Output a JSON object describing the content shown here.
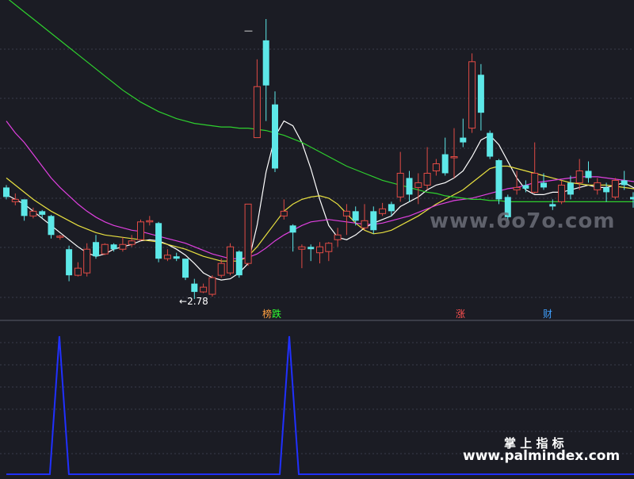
{
  "colors": {
    "background": "#1b1c24",
    "grid": "#3a3d4a",
    "up_candle": "#e14b45",
    "down_candle": "#5de8e8",
    "ma_white": "#ffffff",
    "ma_yellow": "#e8e040",
    "ma_magenta": "#e040e0",
    "ma_green": "#2ed02e",
    "indicator": "#2030ff",
    "watermark_grey": "#6b6e78"
  },
  "annotations": {
    "low_price": "2.78",
    "low_arrow": "←",
    "high_marker": "—",
    "event_labels": [
      {
        "first": "榜",
        "second": "跌",
        "first_color": "#ffa040",
        "second_color": "#30ff30"
      },
      {
        "first": "涨",
        "second": "",
        "first_color": "#ff5050",
        "second_color": ""
      },
      {
        "first": "财",
        "second": "",
        "first_color": "#40a0ff",
        "second_color": ""
      }
    ]
  },
  "watermarks": {
    "site_6070": "www.6o7o.com",
    "palm_title": "掌 上 指 标",
    "palm_url": "www.palmindex.com"
  },
  "chart_data": [
    {
      "type": "candlestick",
      "title": "",
      "candles": [
        {
          "o": 3.72,
          "c": 3.64,
          "h": 3.74,
          "l": 3.62,
          "dir": "down"
        },
        {
          "o": 3.6,
          "c": 3.62,
          "h": 3.67,
          "l": 3.57,
          "dir": "up"
        },
        {
          "o": 3.62,
          "c": 3.48,
          "h": 3.62,
          "l": 3.44,
          "dir": "down"
        },
        {
          "o": 3.48,
          "c": 3.52,
          "h": 3.55,
          "l": 3.46,
          "dir": "up"
        },
        {
          "o": 3.52,
          "c": 3.49,
          "h": 3.53,
          "l": 3.46,
          "dir": "down"
        },
        {
          "o": 3.48,
          "c": 3.32,
          "h": 3.49,
          "l": 3.29,
          "dir": "down"
        },
        {
          "o": 3.3,
          "c": 3.31,
          "h": 3.32,
          "l": 3.28,
          "dir": "up"
        },
        {
          "o": 3.2,
          "c": 2.98,
          "h": 3.23,
          "l": 2.93,
          "dir": "down"
        },
        {
          "o": 2.98,
          "c": 3.04,
          "h": 3.09,
          "l": 2.97,
          "dir": "up"
        },
        {
          "o": 3.0,
          "c": 3.2,
          "h": 3.25,
          "l": 2.97,
          "dir": "up"
        },
        {
          "o": 3.26,
          "c": 3.14,
          "h": 3.32,
          "l": 3.12,
          "dir": "down"
        },
        {
          "o": 3.16,
          "c": 3.24,
          "h": 3.25,
          "l": 3.15,
          "dir": "up"
        },
        {
          "o": 3.24,
          "c": 3.2,
          "h": 3.25,
          "l": 3.18,
          "dir": "down"
        },
        {
          "o": 3.2,
          "c": 3.24,
          "h": 3.3,
          "l": 3.18,
          "dir": "up"
        },
        {
          "o": 3.24,
          "c": 3.27,
          "h": 3.32,
          "l": 3.22,
          "dir": "up"
        },
        {
          "o": 3.28,
          "c": 3.43,
          "h": 3.45,
          "l": 3.27,
          "dir": "up"
        },
        {
          "o": 3.44,
          "c": 3.44,
          "h": 3.48,
          "l": 3.4,
          "dir": "up"
        },
        {
          "o": 3.42,
          "c": 3.12,
          "h": 3.43,
          "l": 3.09,
          "dir": "down"
        },
        {
          "o": 3.12,
          "c": 3.15,
          "h": 3.2,
          "l": 3.1,
          "dir": "up"
        },
        {
          "o": 3.14,
          "c": 3.12,
          "h": 3.17,
          "l": 3.1,
          "dir": "down"
        },
        {
          "o": 3.12,
          "c": 2.96,
          "h": 3.12,
          "l": 2.94,
          "dir": "down"
        },
        {
          "o": 2.91,
          "c": 2.84,
          "h": 2.95,
          "l": 2.78,
          "dir": "down"
        },
        {
          "o": 2.84,
          "c": 2.88,
          "h": 2.91,
          "l": 2.83,
          "dir": "up"
        },
        {
          "o": 2.82,
          "c": 2.96,
          "h": 2.98,
          "l": 2.8,
          "dir": "up"
        },
        {
          "o": 2.98,
          "c": 3.08,
          "h": 3.12,
          "l": 2.96,
          "dir": "up"
        },
        {
          "o": 3.0,
          "c": 3.22,
          "h": 3.25,
          "l": 2.98,
          "dir": "up"
        },
        {
          "o": 3.18,
          "c": 2.98,
          "h": 3.19,
          "l": 2.96,
          "dir": "down"
        },
        {
          "o": 3.08,
          "c": 3.58,
          "h": 3.58,
          "l": 3.06,
          "dir": "up"
        },
        {
          "o": 4.14,
          "c": 4.57,
          "h": 4.8,
          "l": 4.15,
          "dir": "up"
        },
        {
          "o": 4.96,
          "c": 4.58,
          "h": 5.14,
          "l": 4.28,
          "dir": "down"
        },
        {
          "o": 4.42,
          "c": 3.88,
          "h": 4.53,
          "l": 3.85,
          "dir": "down"
        },
        {
          "o": 3.48,
          "c": 3.52,
          "h": 3.62,
          "l": 3.45,
          "dir": "up"
        },
        {
          "o": 3.4,
          "c": 3.34,
          "h": 3.41,
          "l": 3.18,
          "dir": "down"
        },
        {
          "o": 3.2,
          "c": 3.22,
          "h": 3.24,
          "l": 3.04,
          "dir": "up"
        },
        {
          "o": 3.22,
          "c": 3.2,
          "h": 3.24,
          "l": 3.1,
          "dir": "down"
        },
        {
          "o": 3.17,
          "c": 3.22,
          "h": 3.26,
          "l": 3.08,
          "dir": "up"
        },
        {
          "o": 3.18,
          "c": 3.25,
          "h": 3.26,
          "l": 3.1,
          "dir": "up"
        },
        {
          "o": 3.28,
          "c": 3.32,
          "h": 3.38,
          "l": 3.22,
          "dir": "up"
        },
        {
          "o": 3.48,
          "c": 3.52,
          "h": 3.58,
          "l": 3.32,
          "dir": "up"
        },
        {
          "o": 3.52,
          "c": 3.44,
          "h": 3.56,
          "l": 3.4,
          "dir": "down"
        },
        {
          "o": 3.38,
          "c": 3.44,
          "h": 3.58,
          "l": 3.36,
          "dir": "up"
        },
        {
          "o": 3.52,
          "c": 3.36,
          "h": 3.56,
          "l": 3.33,
          "dir": "down"
        },
        {
          "o": 3.5,
          "c": 3.54,
          "h": 3.59,
          "l": 3.48,
          "dir": "up"
        },
        {
          "o": 3.58,
          "c": 3.52,
          "h": 3.6,
          "l": 3.48,
          "dir": "down"
        },
        {
          "o": 3.64,
          "c": 3.84,
          "h": 4.02,
          "l": 3.6,
          "dir": "up"
        },
        {
          "o": 3.8,
          "c": 3.66,
          "h": 3.86,
          "l": 3.6,
          "dir": "down"
        },
        {
          "o": 3.72,
          "c": 3.76,
          "h": 3.84,
          "l": 3.58,
          "dir": "up"
        },
        {
          "o": 3.74,
          "c": 3.84,
          "h": 4.06,
          "l": 3.7,
          "dir": "up"
        },
        {
          "o": 3.86,
          "c": 3.92,
          "h": 3.96,
          "l": 3.82,
          "dir": "up"
        },
        {
          "o": 4.0,
          "c": 3.84,
          "h": 4.14,
          "l": 3.82,
          "dir": "down"
        },
        {
          "o": 3.98,
          "c": 3.98,
          "h": 4.22,
          "l": 3.8,
          "dir": "up"
        },
        {
          "o": 4.14,
          "c": 4.1,
          "h": 4.3,
          "l": 4.06,
          "dir": "down"
        },
        {
          "o": 4.22,
          "c": 4.78,
          "h": 4.85,
          "l": 4.18,
          "dir": "up"
        },
        {
          "o": 4.67,
          "c": 4.35,
          "h": 4.76,
          "l": 4.2,
          "dir": "down"
        },
        {
          "o": 4.18,
          "c": 3.98,
          "h": 4.2,
          "l": 3.96,
          "dir": "down"
        },
        {
          "o": 3.95,
          "c": 3.62,
          "h": 3.96,
          "l": 3.58,
          "dir": "down"
        },
        {
          "o": 3.64,
          "c": 3.47,
          "h": 3.66,
          "l": 3.44,
          "dir": "down"
        },
        {
          "o": 3.7,
          "c": 3.72,
          "h": 3.86,
          "l": 3.66,
          "dir": "up"
        },
        {
          "o": 3.74,
          "c": 3.71,
          "h": 3.78,
          "l": 3.68,
          "dir": "down"
        },
        {
          "o": 3.68,
          "c": 3.84,
          "h": 4.1,
          "l": 3.67,
          "dir": "up"
        },
        {
          "o": 3.76,
          "c": 3.72,
          "h": 3.84,
          "l": 3.7,
          "dir": "down"
        },
        {
          "o": 3.58,
          "c": 3.56,
          "h": 3.62,
          "l": 3.53,
          "dir": "down"
        },
        {
          "o": 3.6,
          "c": 3.74,
          "h": 3.78,
          "l": 3.58,
          "dir": "up"
        },
        {
          "o": 3.76,
          "c": 3.66,
          "h": 3.82,
          "l": 3.62,
          "dir": "down"
        },
        {
          "o": 3.76,
          "c": 3.86,
          "h": 3.96,
          "l": 3.7,
          "dir": "up"
        },
        {
          "o": 3.86,
          "c": 3.8,
          "h": 3.94,
          "l": 3.76,
          "dir": "down"
        },
        {
          "o": 3.7,
          "c": 3.76,
          "h": 3.8,
          "l": 3.66,
          "dir": "up"
        },
        {
          "o": 3.72,
          "c": 3.68,
          "h": 3.76,
          "l": 3.6,
          "dir": "down"
        },
        {
          "o": 3.64,
          "c": 3.78,
          "h": 3.8,
          "l": 3.62,
          "dir": "up"
        },
        {
          "o": 3.78,
          "c": 3.74,
          "h": 3.86,
          "l": 3.7,
          "dir": "down"
        },
        {
          "o": 3.64,
          "c": 3.62,
          "h": 3.68,
          "l": 3.55,
          "dir": "down"
        },
        {
          "o": 3.58,
          "c": 3.52,
          "h": 3.62,
          "l": 3.5,
          "dir": "down"
        }
      ],
      "moving_averages": [
        {
          "color": "#ffffff",
          "values": [
            3.66,
            3.62,
            3.58,
            3.52,
            3.46,
            3.4,
            3.34,
            3.28,
            3.22,
            3.17,
            3.14,
            3.16,
            3.2,
            3.22,
            3.24,
            3.27,
            3.28,
            3.27,
            3.24,
            3.2,
            3.15,
            3.08,
            3.0,
            2.96,
            2.94,
            2.95,
            3.0,
            3.08,
            3.4,
            3.85,
            4.15,
            4.28,
            4.24,
            4.1,
            3.88,
            3.62,
            3.4,
            3.3,
            3.28,
            3.32,
            3.38,
            3.42,
            3.45,
            3.48,
            3.56,
            3.6,
            3.64,
            3.7,
            3.74,
            3.76,
            3.8,
            3.86,
            3.98,
            4.12,
            4.16,
            4.08,
            3.94,
            3.8,
            3.7,
            3.66,
            3.66,
            3.68,
            3.68,
            3.7,
            3.72,
            3.74,
            3.72,
            3.72,
            3.74,
            3.76,
            3.72,
            3.68
          ]
        },
        {
          "color": "#e8e040",
          "values": [
            3.8,
            3.74,
            3.68,
            3.62,
            3.57,
            3.52,
            3.48,
            3.44,
            3.4,
            3.37,
            3.34,
            3.32,
            3.31,
            3.3,
            3.29,
            3.28,
            3.27,
            3.26,
            3.24,
            3.22,
            3.2,
            3.17,
            3.14,
            3.12,
            3.1,
            3.1,
            3.1,
            3.14,
            3.22,
            3.32,
            3.42,
            3.52,
            3.58,
            3.62,
            3.64,
            3.65,
            3.63,
            3.58,
            3.5,
            3.42,
            3.36,
            3.33,
            3.34,
            3.36,
            3.4,
            3.44,
            3.48,
            3.53,
            3.58,
            3.62,
            3.66,
            3.7,
            3.76,
            3.82,
            3.88,
            3.9,
            3.9,
            3.88,
            3.86,
            3.84,
            3.82,
            3.8,
            3.78,
            3.76,
            3.75,
            3.74,
            3.74,
            3.74,
            3.73,
            3.72,
            3.71,
            3.7
          ]
        },
        {
          "color": "#e040e0",
          "values": [
            4.28,
            4.18,
            4.1,
            4.0,
            3.9,
            3.8,
            3.72,
            3.65,
            3.58,
            3.52,
            3.47,
            3.43,
            3.4,
            3.38,
            3.36,
            3.35,
            3.33,
            3.31,
            3.29,
            3.27,
            3.25,
            3.22,
            3.19,
            3.16,
            3.14,
            3.12,
            3.12,
            3.13,
            3.16,
            3.21,
            3.27,
            3.32,
            3.36,
            3.4,
            3.43,
            3.44,
            3.45,
            3.44,
            3.43,
            3.42,
            3.41,
            3.41,
            3.42,
            3.44,
            3.46,
            3.48,
            3.51,
            3.54,
            3.57,
            3.59,
            3.61,
            3.62,
            3.63,
            3.65,
            3.67,
            3.69,
            3.71,
            3.72,
            3.74,
            3.76,
            3.77,
            3.78,
            3.79,
            3.8,
            3.81,
            3.81,
            3.81,
            3.8,
            3.79,
            3.78,
            3.77,
            3.76
          ]
        },
        {
          "color": "#2ed02e",
          "values": [
            5.32,
            5.26,
            5.2,
            5.14,
            5.08,
            5.02,
            4.96,
            4.9,
            4.84,
            4.78,
            4.72,
            4.66,
            4.6,
            4.54,
            4.49,
            4.44,
            4.4,
            4.36,
            4.33,
            4.3,
            4.28,
            4.26,
            4.25,
            4.24,
            4.23,
            4.23,
            4.22,
            4.22,
            4.21,
            4.2,
            4.18,
            4.16,
            4.13,
            4.1,
            4.06,
            4.02,
            3.98,
            3.94,
            3.9,
            3.87,
            3.84,
            3.81,
            3.78,
            3.76,
            3.74,
            3.72,
            3.7,
            3.68,
            3.67,
            3.65,
            3.64,
            3.63,
            3.62,
            3.62,
            3.61,
            3.61,
            3.6,
            3.6,
            3.6,
            3.6,
            3.6,
            3.6,
            3.6,
            3.6,
            3.6,
            3.6,
            3.6,
            3.6,
            3.6,
            3.6,
            3.6,
            3.6
          ]
        }
      ]
    },
    {
      "type": "line",
      "title": "",
      "values": [
        0,
        0,
        0,
        0,
        0,
        0,
        0,
        0,
        0,
        0,
        0,
        0,
        0,
        0,
        0,
        0,
        0,
        0,
        0,
        0,
        0,
        0,
        0,
        0,
        0,
        0,
        0,
        0,
        0,
        0,
        0,
        0,
        0,
        0,
        0,
        0,
        0,
        0,
        0,
        0,
        0,
        0,
        0,
        0,
        0,
        0,
        0,
        0,
        0,
        0,
        0,
        0,
        0,
        0,
        0,
        0,
        0,
        0,
        0,
        0,
        0,
        0,
        0,
        0,
        0,
        0,
        0,
        0,
        0,
        0,
        0,
        0
      ],
      "spikes": [
        {
          "index": 6,
          "value": 1
        },
        {
          "index": 32,
          "value": 1
        }
      ],
      "ylim": [
        0,
        1
      ]
    }
  ]
}
